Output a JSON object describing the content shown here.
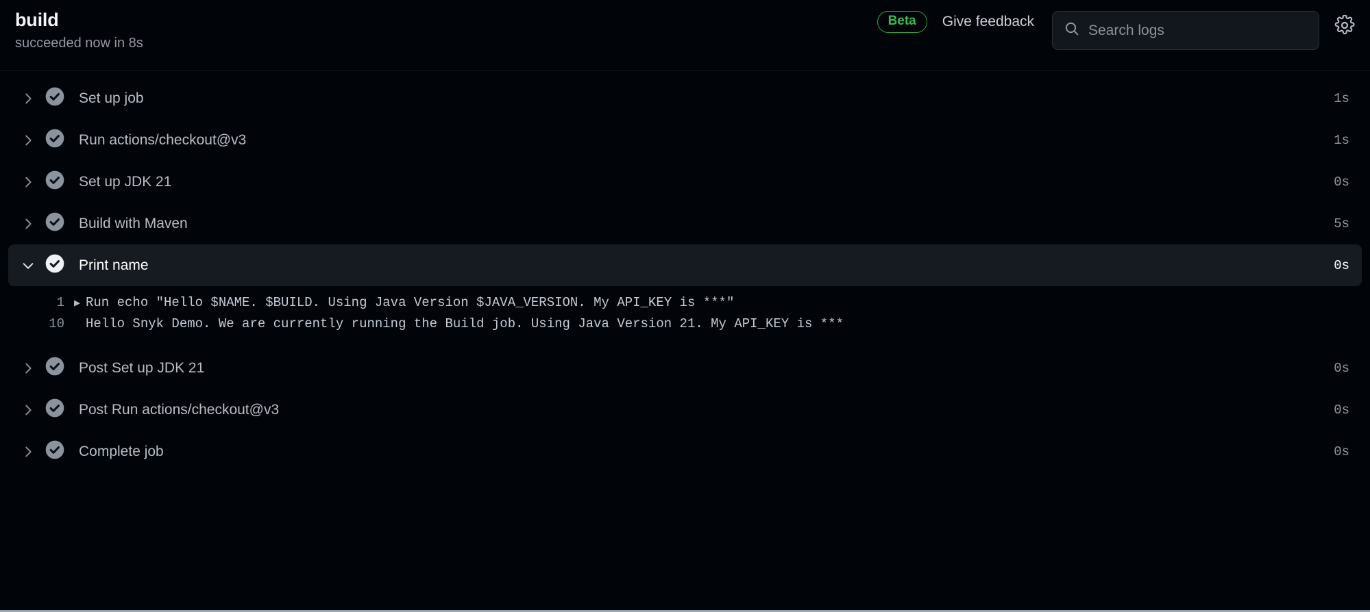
{
  "header": {
    "job_title": "build",
    "job_status": "succeeded now in 8s",
    "beta_badge": "Beta",
    "give_feedback": "Give feedback",
    "search_placeholder": "Search logs",
    "search_value": "",
    "search_icon": "search-icon",
    "settings_icon": "gear-icon",
    "accent_green": "#3fb950",
    "background": "#010409"
  },
  "steps": [
    {
      "name": "Set up job",
      "duration": "1s",
      "status": "success",
      "expanded": false
    },
    {
      "name": "Run actions/checkout@v3",
      "duration": "1s",
      "status": "success",
      "expanded": false
    },
    {
      "name": "Set up JDK 21",
      "duration": "0s",
      "status": "success",
      "expanded": false
    },
    {
      "name": "Build with Maven",
      "duration": "5s",
      "status": "success",
      "expanded": false
    },
    {
      "name": "Print name",
      "duration": "0s",
      "status": "success",
      "expanded": true
    },
    {
      "name": "Post Set up JDK 21",
      "duration": "0s",
      "status": "success",
      "expanded": false
    },
    {
      "name": "Post Run actions/checkout@v3",
      "duration": "0s",
      "status": "success",
      "expanded": false
    },
    {
      "name": "Complete job",
      "duration": "0s",
      "status": "success",
      "expanded": false
    }
  ],
  "log": {
    "lines": [
      {
        "number": "1",
        "marker": "▶",
        "text": "Run echo \"Hello $NAME. $BUILD. Using Java Version $JAVA_VERSION. My API_KEY is ***\""
      },
      {
        "number": "10",
        "marker": "",
        "text": "Hello Snyk Demo. We are currently running the Build job. Using Java Version 21. My API_KEY is ***"
      }
    ]
  }
}
